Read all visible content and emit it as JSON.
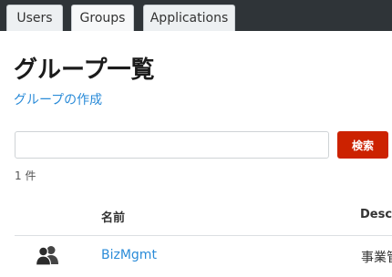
{
  "tabs": [
    {
      "label": "Users"
    },
    {
      "label": "Groups"
    },
    {
      "label": "Applications"
    }
  ],
  "page": {
    "title": "グループ一覧",
    "create_link": "グループの作成"
  },
  "search": {
    "value": "",
    "button_label": "検索"
  },
  "results": {
    "count": "1 件"
  },
  "table": {
    "headers": {
      "name": "名前",
      "description": "Descr"
    },
    "rows": [
      {
        "icon": "group-icon",
        "name": "BizMgmt",
        "description": "事業管"
      }
    ]
  },
  "colors": {
    "topbar": "#2f3438",
    "link": "#2a8bd8",
    "search_button": "#cc2200"
  }
}
